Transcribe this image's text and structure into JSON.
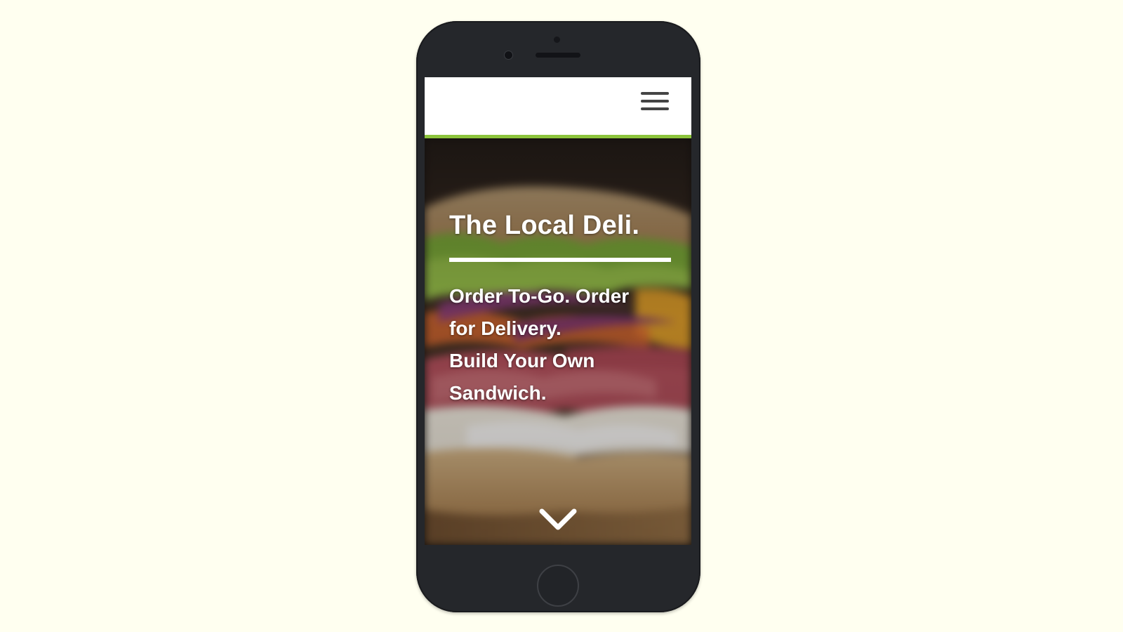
{
  "header": {
    "menu_icon": "hamburger-menu-icon"
  },
  "hero": {
    "title": "The Local Deli.",
    "tagline_lines": [
      "Order To-Go. Order",
      "for Delivery.",
      "Build Your Own",
      "Sandwich."
    ],
    "scroll_icon": "chevron-down-icon"
  },
  "colors": {
    "accent": "#8cc43c",
    "header_bg": "#ffffff",
    "hero_text": "#ffffff",
    "phone_body": "#25272b",
    "page_bg": "#fffff0"
  }
}
